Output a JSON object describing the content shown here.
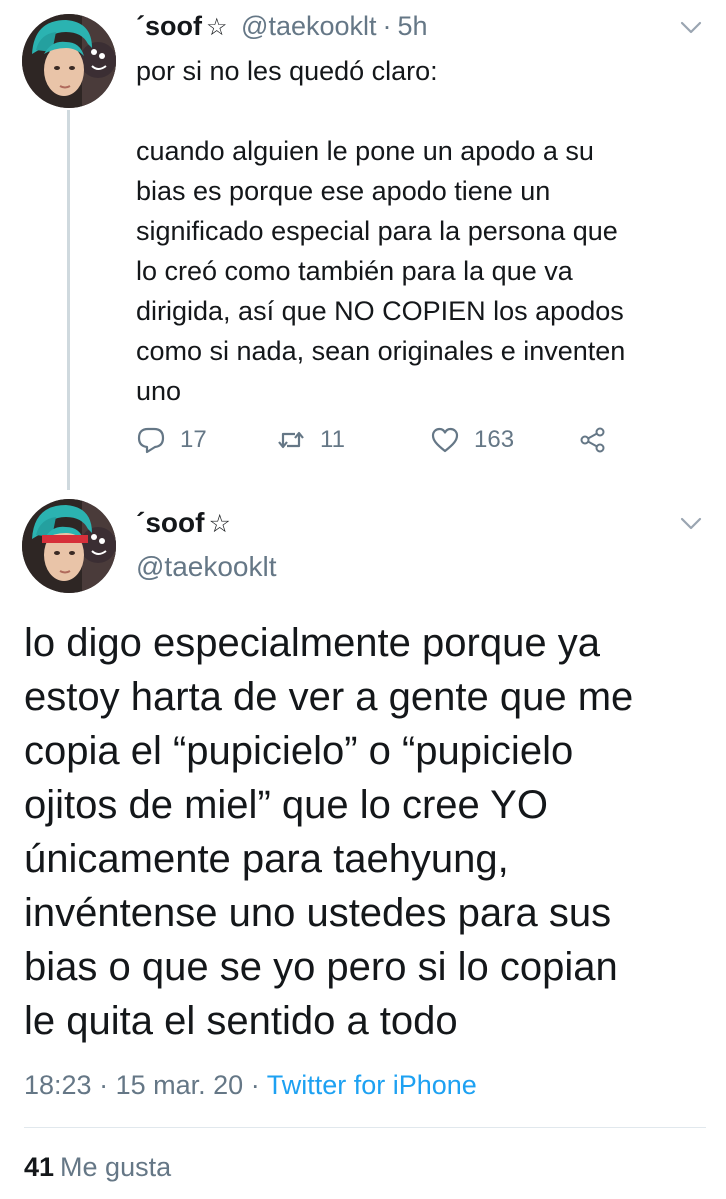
{
  "tweet1": {
    "name_prefix": "´",
    "name": "soof",
    "star": "☆",
    "handle": "@taekooklt",
    "separator": "·",
    "time": "5h",
    "text_intro": "por si no les quedó claro:",
    "text_lines": [
      "cuando alguien le pone un apodo a su",
      "bias es porque ese apodo tiene un",
      "significado especial para la persona que",
      "lo creó como también para la que va",
      "dirigida, así que NO COPIEN los apodos",
      "como si nada, sean originales e inventen",
      "uno"
    ],
    "actions": {
      "replies": "17",
      "retweets": "11",
      "likes": "163"
    }
  },
  "tweet2": {
    "name_prefix": "´",
    "name": "soof",
    "star": "☆",
    "handle": "@taekooklt",
    "text_lines": [
      "lo digo especialmente porque ya",
      "estoy harta de ver a gente que me",
      "copia el “pupicielo” o “pupicielo",
      "ojitos de miel” que lo cree YO",
      "únicamente para taehyung,",
      "invéntense uno ustedes para sus",
      "bias o que se yo pero si lo copian",
      "le quita el sentido a todo"
    ],
    "time": "18:23",
    "separator": "·",
    "date": "15 mar. 20",
    "source": "Twitter for iPhone",
    "like_count": "41",
    "like_label": "Me gusta"
  },
  "icons": {
    "reply": "reply-icon",
    "retweet": "retweet-icon",
    "like": "heart-icon",
    "share": "share-icon",
    "menu": "chevron-down-icon"
  },
  "colors": {
    "text": "#14171a",
    "secondary": "#657786",
    "link": "#1da1f2",
    "thread_line": "#cfd9de"
  }
}
